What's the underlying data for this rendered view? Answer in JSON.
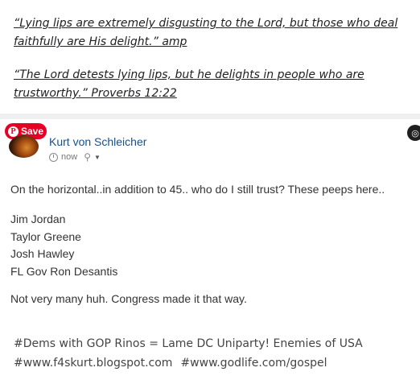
{
  "quotes": [
    "“Lying lips are extremely disgusting to the Lord, but those who deal faithfully are His delight.” amp",
    "“The Lord detests lying lips, but he delights in people who are trustworthy.” Proverbs 12:22"
  ],
  "save_button": {
    "label": "Save",
    "icon": "P"
  },
  "post": {
    "author": "Kurt von Schleicher",
    "time": "now",
    "body": "On the horizontal..in addition to 45.. who do I still trust? These peeps here..",
    "names": [
      "Jim Jordan",
      "Taylor Greene",
      "Josh Hawley",
      "FL Gov Ron Desantis"
    ],
    "closing": "Not very many huh. Congress made it that way."
  },
  "hashtags": {
    "line1": "#Dems with GOP Rinos = Lame DC Uniparty! Enemies of USA",
    "link1": "#www.f4skurt.blogspot.com",
    "link2": "#www.godlife.com/gospel"
  },
  "icons": {
    "save": "pinterest-icon",
    "time": "clock-icon",
    "audience": "person-icon",
    "menu": "caret-down-icon",
    "corner": "lens-icon"
  },
  "colors": {
    "save_bg": "#e60023",
    "author": "#1a4f8a"
  }
}
